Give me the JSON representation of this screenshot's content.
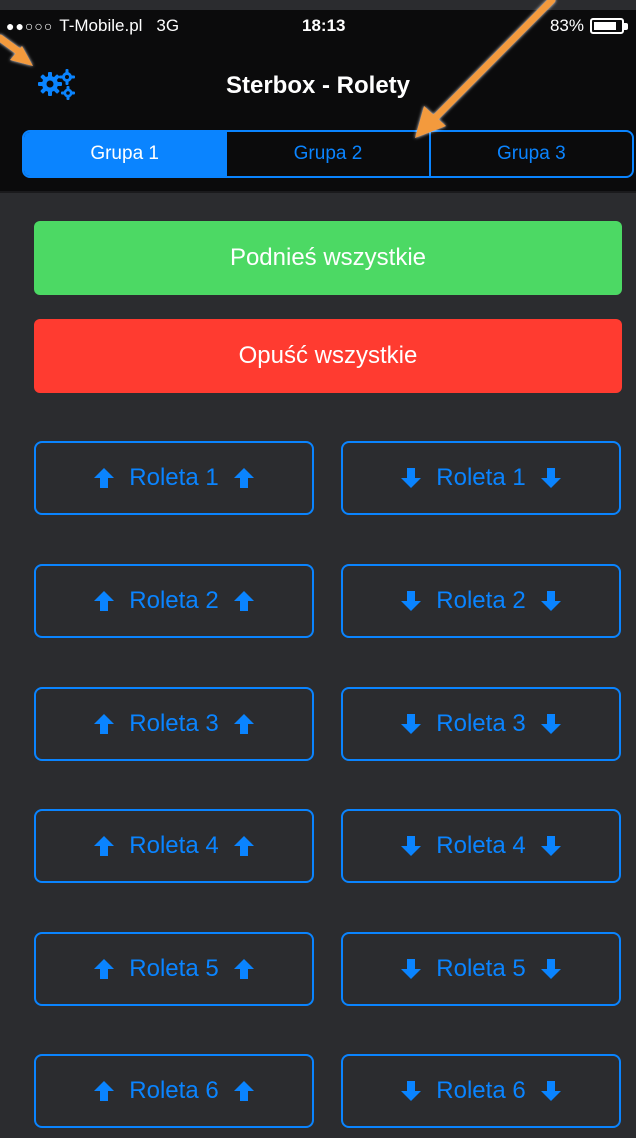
{
  "status_bar": {
    "signal": "●●○○○",
    "carrier": "T-Mobile.pl",
    "network": "3G",
    "time": "18:13",
    "battery": "83%"
  },
  "nav": {
    "title": "Sterbox - Rolety",
    "settings_icon": "gears-icon"
  },
  "segments": [
    {
      "label": "Grupa 1",
      "selected": true
    },
    {
      "label": "Grupa 2",
      "selected": false
    },
    {
      "label": "Grupa 3",
      "selected": false
    }
  ],
  "actions": {
    "raise_all": "Podnieś wszystkie",
    "lower_all": "Opuść wszystkie"
  },
  "rows": [
    {
      "up": "Roleta 1",
      "down": "Roleta 1"
    },
    {
      "up": "Roleta 2",
      "down": "Roleta 2"
    },
    {
      "up": "Roleta 3",
      "down": "Roleta 3"
    },
    {
      "up": "Roleta 4",
      "down": "Roleta 4"
    },
    {
      "up": "Roleta 5",
      "down": "Roleta 5"
    },
    {
      "up": "Roleta 6",
      "down": "Roleta 6"
    }
  ],
  "colors": {
    "accent": "#0a84ff",
    "green": "#4cd964",
    "red": "#ff3b30",
    "background": "#2b2c2f",
    "annotation": "#f39a3c"
  }
}
